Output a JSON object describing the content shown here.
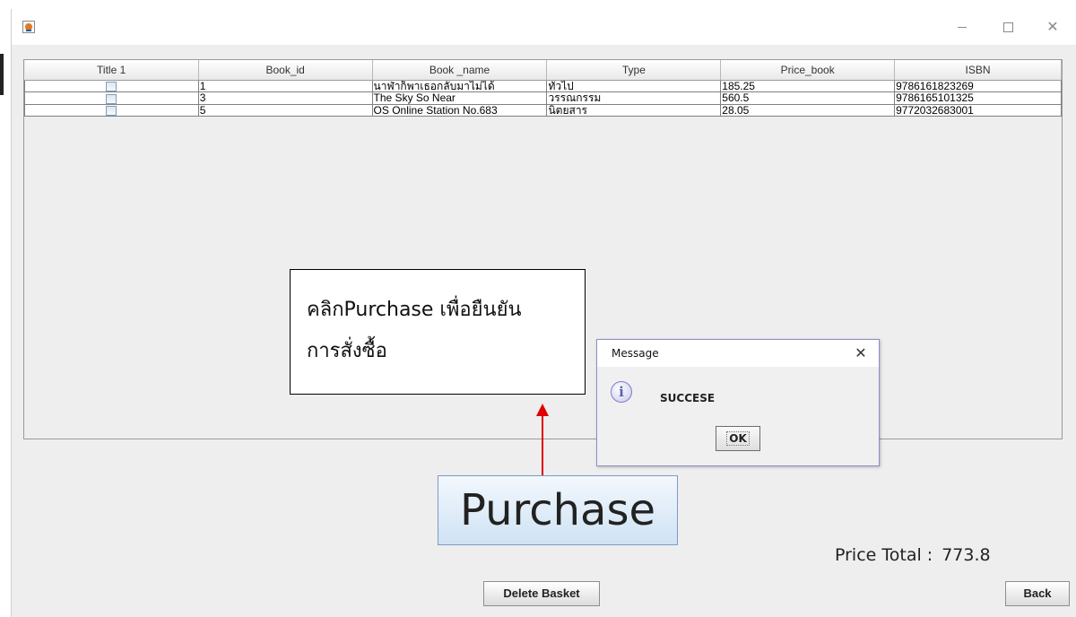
{
  "window": {
    "icon": "java-cup-icon",
    "controls": {
      "minimize": "minimize-icon",
      "maximize": "maximize-icon",
      "close": "close-icon"
    }
  },
  "table": {
    "headers": [
      "Title 1",
      "Book_id",
      "Book _name",
      "Type",
      "Price_book",
      "ISBN"
    ],
    "rows": [
      {
        "checked": false,
        "book_id": "1",
        "book_name": "นาฬ่าก็พาเธอกลับมาไม่ได้",
        "type": "ทั่วไป",
        "price": "185.25",
        "isbn": "9786161823269"
      },
      {
        "checked": false,
        "book_id": "3",
        "book_name": "The Sky So Near",
        "type": "วรรณกรรม",
        "price": "560.5",
        "isbn": "9786165101325"
      },
      {
        "checked": false,
        "book_id": "5",
        "book_name": "OS Online Station No.683",
        "type": "นิตยสาร",
        "price": "28.05",
        "isbn": "9772032683001"
      }
    ]
  },
  "annotation": {
    "line1": "คลิกPurchase เพื่อยืนยัน",
    "line2": "การสั่งซื้อ",
    "arrow_color": "#e00000"
  },
  "purchase": {
    "label": "Purchase"
  },
  "price_total": {
    "label": "Price Total :",
    "value": "773.8"
  },
  "buttons": {
    "delete_basket": "Delete Basket",
    "back": "Back"
  },
  "dialog": {
    "title": "Message",
    "close_glyph": "✕",
    "icon": "info-icon",
    "icon_glyph": "i",
    "message": "SUCCESE",
    "ok_label": "OK"
  },
  "colors": {
    "accent_border": "#7a9cc6",
    "dialog_border": "#8a8fc8"
  }
}
